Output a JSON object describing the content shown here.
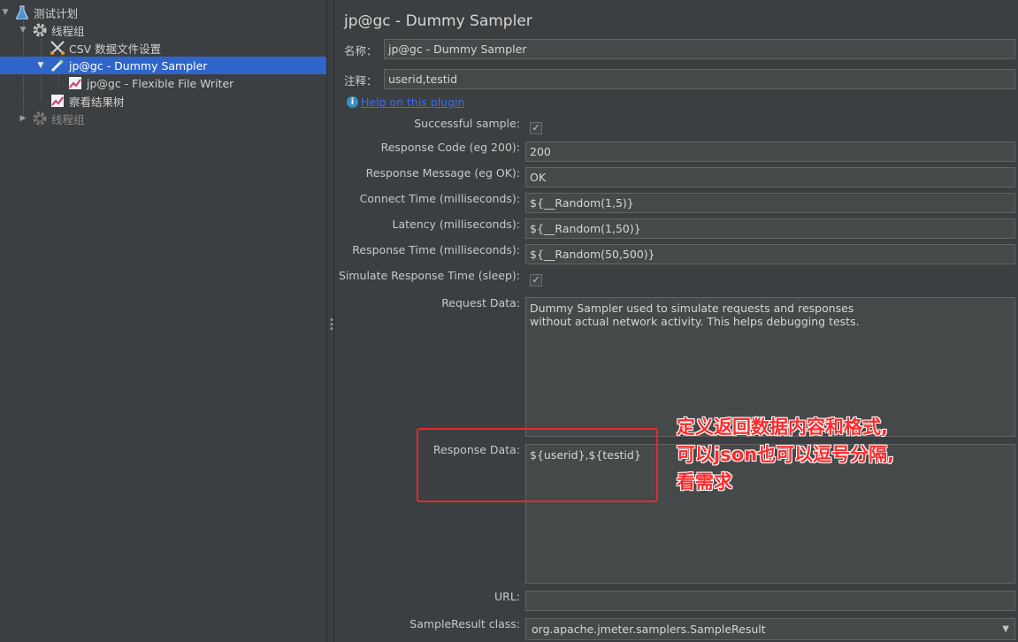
{
  "tree": {
    "items": [
      {
        "label": "测试计划",
        "icon": "flask-icon"
      },
      {
        "label": "线程组",
        "icon": "gear-icon"
      },
      {
        "label": "CSV 数据文件设置",
        "icon": "scissors-icon"
      },
      {
        "label": "jp@gc - Dummy Sampler",
        "icon": "pipette-icon"
      },
      {
        "label": "jp@gc - Flexible File Writer",
        "icon": "chart-icon"
      },
      {
        "label": "察看结果树",
        "icon": "chart-icon"
      },
      {
        "label": "线程组",
        "icon": "gear-icon"
      }
    ]
  },
  "panel": {
    "title": "jp@gc - Dummy Sampler",
    "name_label": "名称：",
    "name_value": "jp@gc - Dummy Sampler",
    "comment_label": "注释：",
    "comment_value": "userid,testid",
    "help_link": "Help on this plugin"
  },
  "form": {
    "successful_label": "Successful sample:",
    "successful_checked": true,
    "code_label": "Response Code (eg 200):",
    "code_value": "200",
    "message_label": "Response Message (eg OK):",
    "message_value": "OK",
    "connect_label": "Connect Time (milliseconds):",
    "connect_value": "${__Random(1,5)}",
    "latency_label": "Latency (milliseconds):",
    "latency_value": "${__Random(1,50)}",
    "response_time_label": "Response Time (milliseconds):",
    "response_time_value": "${__Random(50,500)}",
    "simulate_label": "Simulate Response Time (sleep):",
    "simulate_checked": true,
    "request_label": "Request Data:",
    "request_value": "Dummy Sampler used to simulate requests and responses\nwithout actual network activity. This helps debugging tests.",
    "response_label": "Response Data:",
    "response_value": "${userid},${testid}",
    "url_label": "URL:",
    "url_value": "",
    "class_label": "SampleResult class:",
    "class_value": "org.apache.jmeter.samplers.SampleResult"
  },
  "annotation": {
    "lines": [
      "定义返回数据内容和格式,",
      "可以json也可以逗号分隔,",
      "看需求"
    ],
    "color": "#ff2b2b"
  }
}
